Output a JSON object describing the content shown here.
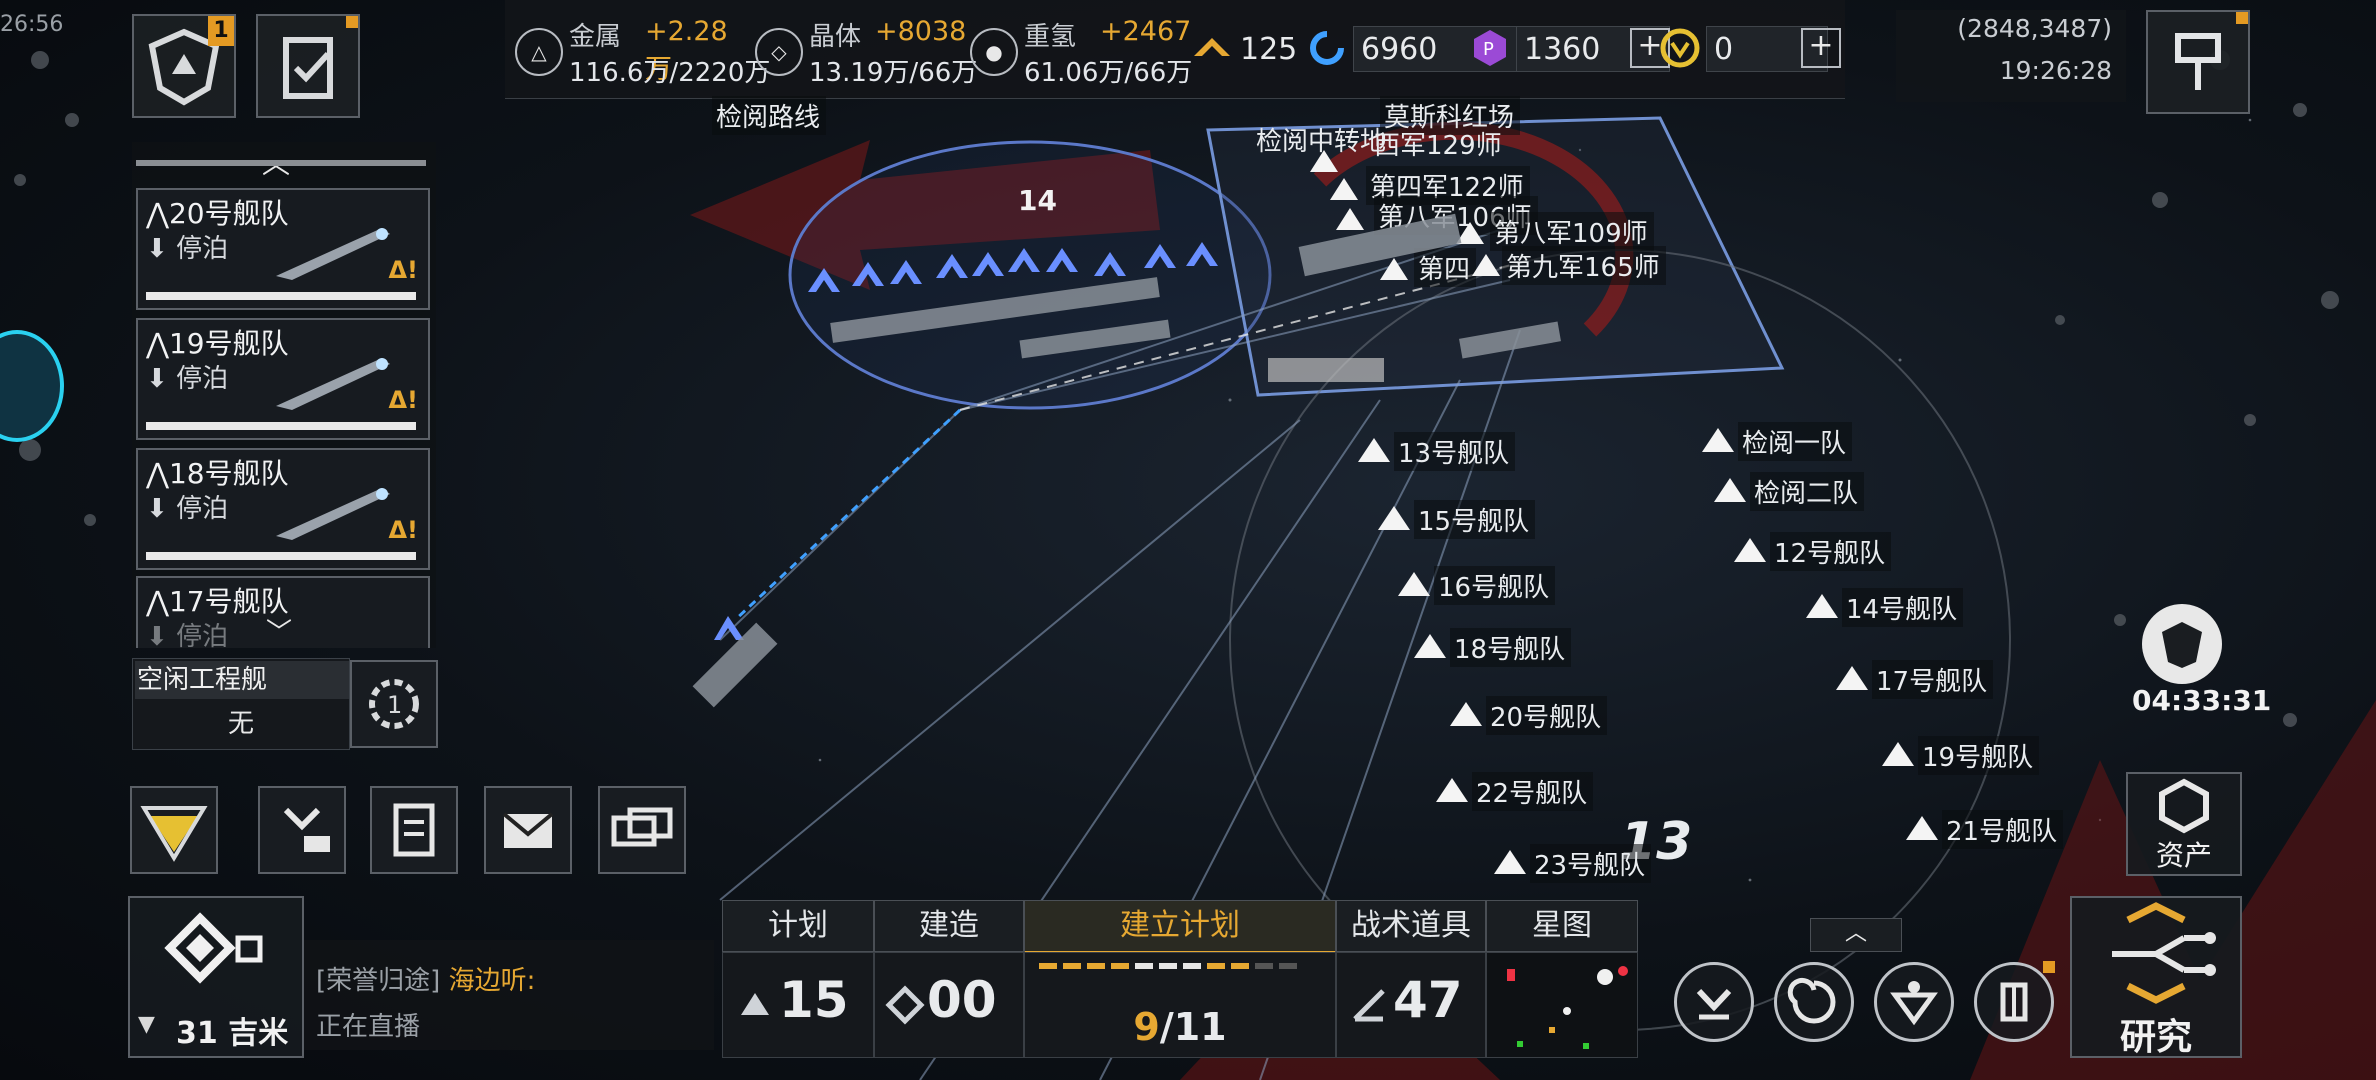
{
  "top_left": {
    "clock_partial": "26:56",
    "alliance_badge": "1"
  },
  "resources": [
    {
      "name": "金属",
      "delta": "+2.28万",
      "amount": "116.6万/2220万",
      "icon": "metal-icon"
    },
    {
      "name": "晶体",
      "delta": "+8038",
      "amount": "13.19万/66万",
      "icon": "crystal-icon"
    },
    {
      "name": "重氢",
      "delta": "+2467",
      "amount": "61.06万/66万",
      "icon": "deuterium-icon"
    }
  ],
  "currencies": {
    "energy": "125",
    "credits": "6960",
    "premium": "1360",
    "gold": "0"
  },
  "coords": {
    "position": "(2848,3487)",
    "time": "19:26:28"
  },
  "map": {
    "review_route": "检阅路线",
    "red_square": "莫斯科红场",
    "transit": "检阅中转地",
    "group_count": "14",
    "sector_mark": "13",
    "divisions": [
      "西军129师",
      "第四军122师",
      "第八军106师",
      "第八军109师",
      "第四",
      "第九军165师"
    ],
    "fleets_left": [
      "13号舰队",
      "15号舰队",
      "16号舰队",
      "18号舰队",
      "20号舰队",
      "22号舰队",
      "23号舰队"
    ],
    "fleets_right": [
      "检阅一队",
      "检阅二队",
      "12号舰队",
      "14号舰队",
      "17号舰队",
      "19号舰队",
      "21号舰队"
    ]
  },
  "fleet_list": [
    {
      "name": "20号舰队",
      "status": "停泊"
    },
    {
      "name": "19号舰队",
      "status": "停泊"
    },
    {
      "name": "18号舰队",
      "status": "停泊"
    },
    {
      "name": "17号舰队",
      "status": "停泊"
    }
  ],
  "engineer": {
    "label": "空闲工程舰",
    "value": "无"
  },
  "timer": "04:33:31",
  "assets_label": "资产",
  "research_label": "研究",
  "chat": {
    "channel": "[荣誉归途]",
    "user": "海边听:",
    "message": "正在直播"
  },
  "zoom": "31 吉米",
  "bottom_tabs": [
    "计划",
    "建造",
    "建立计划",
    "战术道具",
    "星图"
  ],
  "bottom_values": {
    "plan": "15",
    "build": "00",
    "progress": "9",
    "progress_total": "/11",
    "tactics": "47"
  },
  "colors": {
    "accent": "#e6a832",
    "fleet_blue": "#5b8cff",
    "danger_red": "#8e1d1d"
  }
}
